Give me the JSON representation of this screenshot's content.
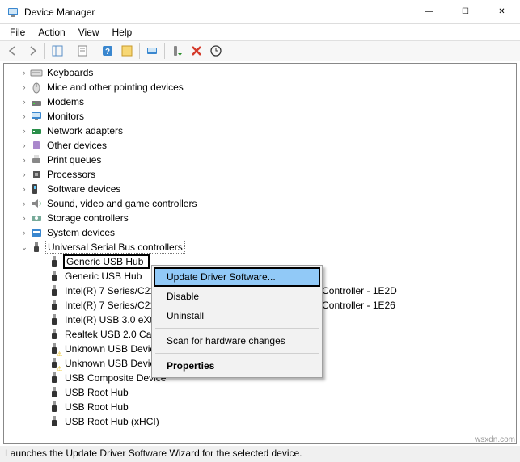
{
  "window": {
    "title": "Device Manager",
    "minimize": "—",
    "maximize": "☐",
    "close": "✕"
  },
  "menu": {
    "file": "File",
    "action": "Action",
    "view": "View",
    "help": "Help"
  },
  "tree": {
    "categories": [
      {
        "icon": "keyboard",
        "label": "Keyboards"
      },
      {
        "icon": "mouse",
        "label": "Mice and other pointing devices"
      },
      {
        "icon": "modem",
        "label": "Modems"
      },
      {
        "icon": "monitor",
        "label": "Monitors"
      },
      {
        "icon": "network",
        "label": "Network adapters"
      },
      {
        "icon": "other",
        "label": "Other devices"
      },
      {
        "icon": "printer",
        "label": "Print queues"
      },
      {
        "icon": "cpu",
        "label": "Processors"
      },
      {
        "icon": "software",
        "label": "Software devices"
      },
      {
        "icon": "sound",
        "label": "Sound, video and game controllers"
      },
      {
        "icon": "storage",
        "label": "Storage controllers"
      },
      {
        "icon": "system",
        "label": "System devices"
      },
      {
        "icon": "usb",
        "label": "Universal Serial Bus controllers",
        "expanded": true
      }
    ],
    "usb_children": [
      {
        "label": "Generic USB Hub",
        "selected": true
      },
      {
        "label": "Generic USB Hub"
      },
      {
        "label": "Intel(R) 7 Series/C216 Chipset Family USB Enhanced Host Controller - 1E2D"
      },
      {
        "label": "Intel(R) 7 Series/C216 Chipset Family USB Enhanced Host Controller - 1E26"
      },
      {
        "label": "Intel(R) USB 3.0 eXtensible Host Controller"
      },
      {
        "label": "Realtek USB 2.0 Card Reader"
      },
      {
        "label": "Unknown USB Device (Device Descriptor Request Failed)",
        "warn": true
      },
      {
        "label": "Unknown USB Device (Device Descriptor Request Failed)",
        "warn": true
      },
      {
        "label": "USB Composite Device"
      },
      {
        "label": "USB Root Hub"
      },
      {
        "label": "USB Root Hub"
      },
      {
        "label": "USB Root Hub (xHCI)"
      }
    ]
  },
  "context_menu": {
    "update": "Update Driver Software...",
    "disable": "Disable",
    "uninstall": "Uninstall",
    "scan": "Scan for hardware changes",
    "properties": "Properties"
  },
  "statusbar": "Launches the Update Driver Software Wizard for the selected device.",
  "watermark": "wsxdn.com"
}
